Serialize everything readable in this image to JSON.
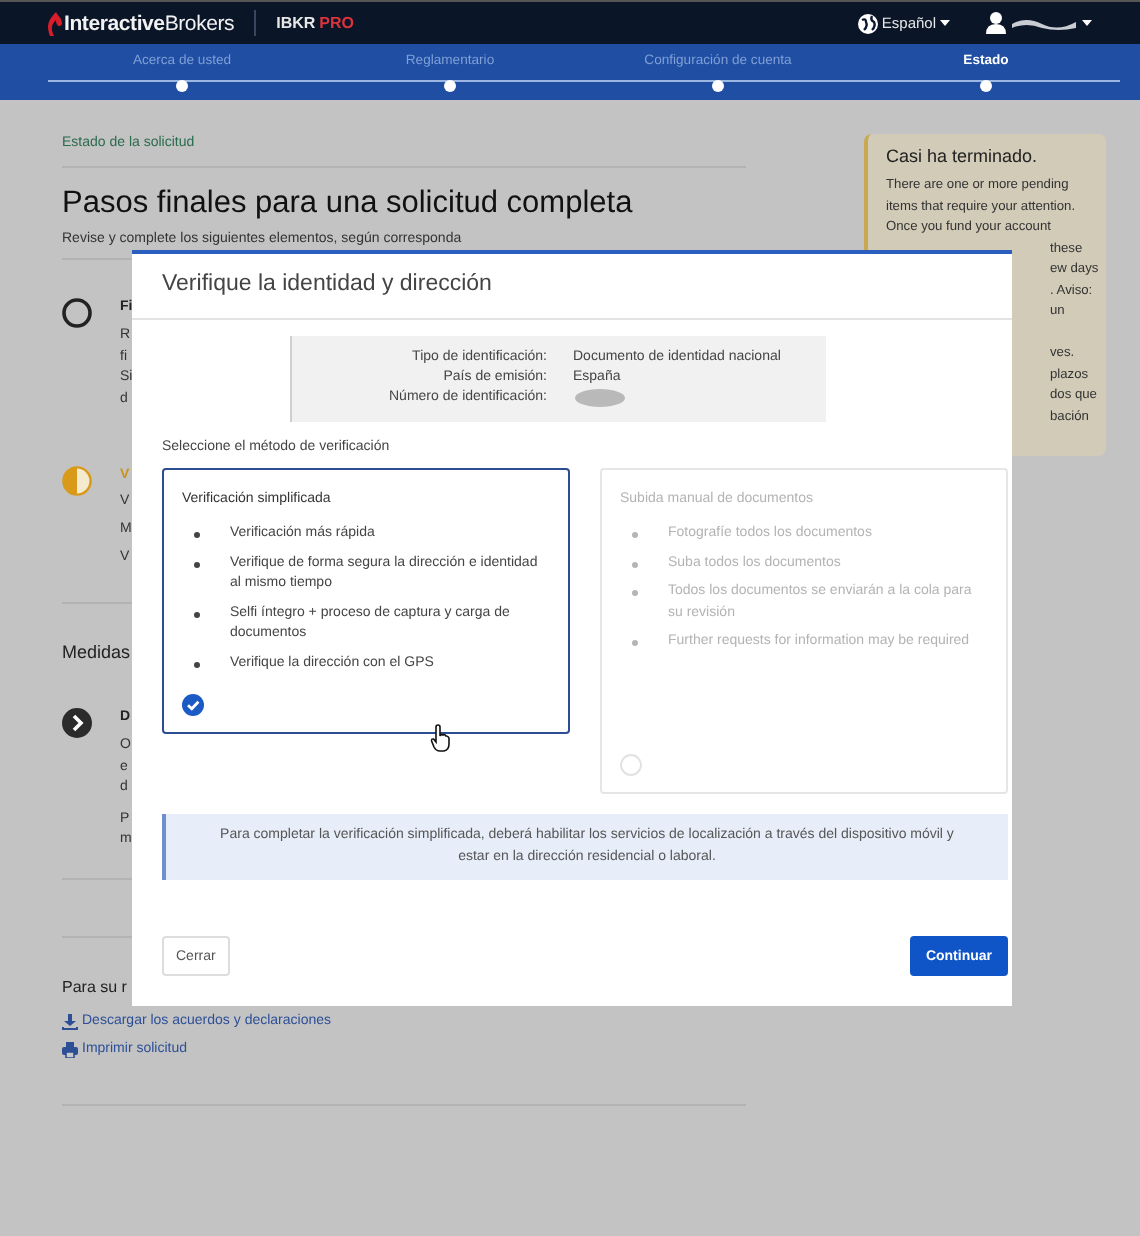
{
  "header": {
    "logo": "**Interactive**Brokers",
    "product": "IBKR",
    "product_tier": "PRO",
    "language": "Español",
    "user_redacted": true
  },
  "steps": [
    {
      "label": "Acerca de usted",
      "selected": false
    },
    {
      "label": "Reglamentario",
      "selected": false
    },
    {
      "label": "Configuración de cuenta",
      "selected": false
    },
    {
      "label": "Estado",
      "selected": true
    }
  ],
  "page": {
    "breadcrumb": "Estado de la solicitud",
    "title": "Pasos finales para una solicitud completa",
    "subtitle": "Revise y complete los siguientes elementos, según corresponda",
    "items": [
      {
        "kind": "empty",
        "title": "Fi",
        "paragraphs": [
          [
            "R",
            "fi",
            "Si",
            "d"
          ]
        ]
      },
      {
        "kind": "partial",
        "title": "V",
        "paragraphs": [
          [
            "V"
          ],
          [
            "M"
          ],
          [
            "V"
          ]
        ]
      }
    ],
    "section_title": "Medidas",
    "section_items": [
      {
        "kind": "action",
        "title": "D",
        "paragraphs": [
          [
            "O",
            "e",
            "d"
          ],
          [
            "P",
            "m"
          ]
        ]
      }
    ],
    "reference_title": "Para su r",
    "links": [
      {
        "kind": "download",
        "label": "Descargar los acuerdos y declaraciones"
      },
      {
        "kind": "print",
        "label": "Imprimir solicitud"
      }
    ]
  },
  "sidebar": {
    "title": "Casi ha terminado.",
    "lines": [
      "There are one or more pending",
      "items that require your attention.",
      "Once you fund your account"
    ],
    "cut_paragraphs": [
      [
        "these",
        "ew days",
        ". Aviso:",
        "un"
      ],
      [
        "ves.",
        "plazos",
        "dos que",
        "bación"
      ]
    ]
  },
  "modal": {
    "title": "Verifique la identidad y dirección",
    "id_details": [
      {
        "label": "Tipo de identificación:",
        "value": "Documento de identidad nacional"
      },
      {
        "label": "País de emisión:",
        "value": "España"
      },
      {
        "label": "Número de identificación:",
        "redacted": true
      }
    ],
    "method_prompt": "Seleccione el método de verificación",
    "methods": [
      {
        "title": "Verificación simplificada",
        "selected": true,
        "disabled": false,
        "bullets": [
          "Verificación más rápida",
          "Verifique de forma segura la dirección e identidad al mismo tiempo",
          "Selfi íntegro + proceso de captura y carga de documentos",
          "Verifique la dirección con el GPS"
        ]
      },
      {
        "title": "Subida manual de documentos",
        "selected": false,
        "disabled": true,
        "bullets": [
          "Fotografíe todos los documentos",
          "Suba todos los documentos",
          "Todos los documentos se enviarán a la cola para su revisión",
          "Further requests for information may be required"
        ]
      }
    ],
    "info": "Para completar la verificación simplificada, deberá habilitar los servicios de localización a través del dispositivo móvil y estar en la dirección residencial o laboral.",
    "buttons": [
      {
        "kind": "secondary",
        "label": "Cerrar"
      },
      {
        "kind": "primary",
        "label": "Continuar"
      }
    ]
  }
}
